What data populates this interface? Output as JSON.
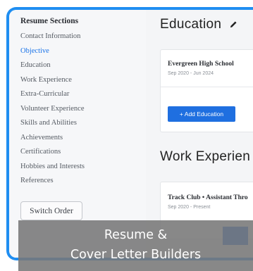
{
  "sidebar": {
    "title": "Resume Sections",
    "items": [
      {
        "label": "Contact Information",
        "active": false
      },
      {
        "label": "Objective",
        "active": true
      },
      {
        "label": "Education",
        "active": false
      },
      {
        "label": "Work Experience",
        "active": false
      },
      {
        "label": "Extra-Curricular",
        "active": false
      },
      {
        "label": "Volunteer Experience",
        "active": false
      },
      {
        "label": "Skills and Abilities",
        "active": false
      },
      {
        "label": "Achievements",
        "active": false
      },
      {
        "label": "Certifications",
        "active": false
      },
      {
        "label": "Hobbies and Interests",
        "active": false
      },
      {
        "label": "References",
        "active": false
      }
    ],
    "switch_order_label": "Switch Order"
  },
  "education": {
    "title": "Education",
    "entry_name": "Evergreen High School",
    "entry_date": "Sep 2020 - Jun 2024",
    "add_label": "+ Add Education"
  },
  "work": {
    "title": "Work Experien",
    "entry_name": "Track Club • Assistant Thro",
    "entry_date": "Sep 2020 - Present"
  },
  "overlay": {
    "line1": "Resume &",
    "line2": "Cover Letter Builders"
  },
  "colors": {
    "accent": "#1f8ef1",
    "button": "#1f6fe0",
    "active_link": "#1a73e8"
  }
}
